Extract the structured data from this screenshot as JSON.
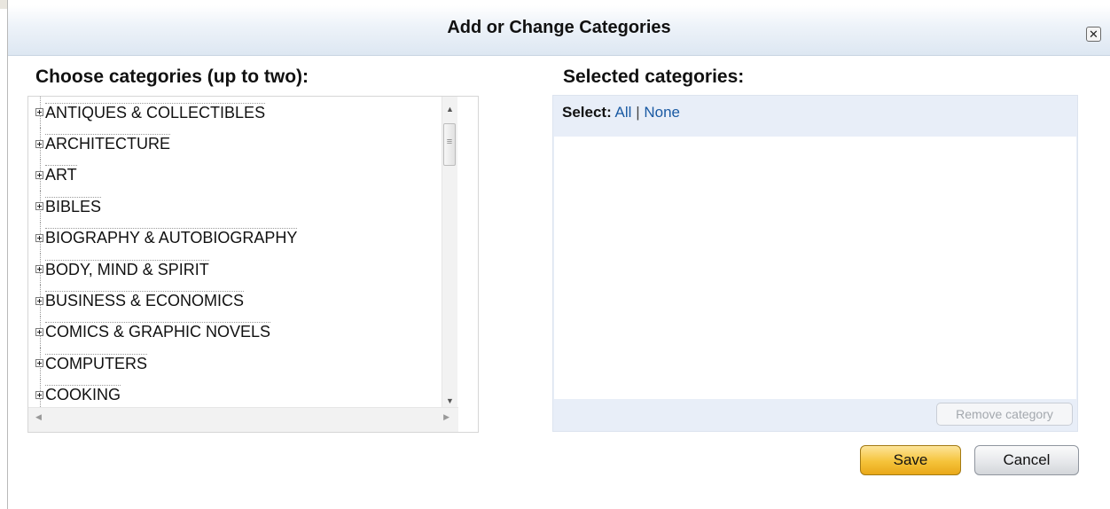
{
  "dialog": {
    "title": "Add or Change Categories",
    "close_icon": "close-icon"
  },
  "left_panel": {
    "heading": "Choose categories (up to two):",
    "categories": [
      "ANTIQUES & COLLECTIBLES",
      "ARCHITECTURE",
      "ART",
      "BIBLES",
      "BIOGRAPHY & AUTOBIOGRAPHY",
      "BODY, MIND & SPIRIT",
      "BUSINESS & ECONOMICS",
      "COMICS & GRAPHIC NOVELS",
      "COMPUTERS",
      "COOKING"
    ]
  },
  "right_panel": {
    "heading": "Selected categories:",
    "select_label": "Select:",
    "select_all": "All",
    "select_separator": "|",
    "select_none": "None",
    "remove_button": "Remove category"
  },
  "buttons": {
    "save": "Save",
    "cancel": "Cancel"
  },
  "colors": {
    "link": "#1a5aa3",
    "save_button": "#f5c33a",
    "selected_panel_bg": "#e8eef8"
  }
}
